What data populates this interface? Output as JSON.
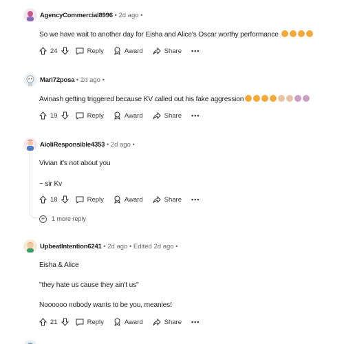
{
  "comments": [
    {
      "author": "AgencyCommercial8996",
      "meta": " • 2d ago •",
      "lines": [
        "So we have wait to another day for Eisha and Alice's Oscar worthy performance"
      ],
      "score": "24",
      "reply": "Reply",
      "award": "Award",
      "share": "Share",
      "more": "•••"
    },
    {
      "author": "Mari72posa",
      "meta": " • 2d ago •",
      "lines": [
        "Avinash getting triggered because KV called out his fake aggression"
      ],
      "score": "19",
      "reply": "Reply",
      "award": "Award",
      "share": "Share",
      "more": "•••"
    },
    {
      "author": "AioliResponsible4353",
      "meta": " • 2d ago •",
      "lines": [
        "Vivian it's not about you",
        "~ sir Kv"
      ],
      "score": "18",
      "reply": "Reply",
      "award": "Award",
      "share": "Share",
      "more": "•••",
      "more_replies": "1 more reply"
    },
    {
      "author": "UpbeatIntention6241",
      "meta": " • 2d ago • Edited 2d ago •",
      "lines": [
        "Eisha & Alice",
        "\"they hate us cause they ain't us\"",
        "Noooooo nobody wants to be you, meanies!"
      ],
      "score": "21",
      "reply": "Reply",
      "award": "Award",
      "share": "Share",
      "more": "•••"
    }
  ],
  "colors": {
    "text": "#1c1c1c",
    "meta": "#6a6a6a",
    "thread": "#dedede",
    "emoji": "#f2a93b"
  }
}
